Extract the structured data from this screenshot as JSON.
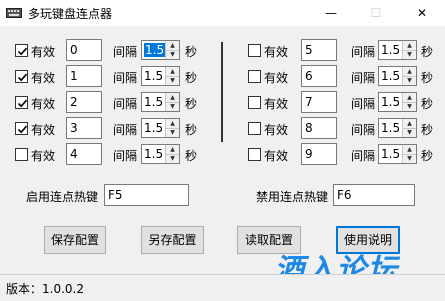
{
  "window": {
    "title": "多玩键盘连点器",
    "minimize": "—",
    "maximize": "☐",
    "close": "✕"
  },
  "rows_left": [
    {
      "checked": true,
      "enabled_label": "有效",
      "key": "0",
      "interval_label": "间隔",
      "interval": "1.5",
      "unit": "秒",
      "selected": true
    },
    {
      "checked": true,
      "enabled_label": "有效",
      "key": "1",
      "interval_label": "间隔",
      "interval": "1.5",
      "unit": "秒",
      "selected": false
    },
    {
      "checked": true,
      "enabled_label": "有效",
      "key": "2",
      "interval_label": "间隔",
      "interval": "1.5",
      "unit": "秒",
      "selected": false
    },
    {
      "checked": true,
      "enabled_label": "有效",
      "key": "3",
      "interval_label": "间隔",
      "interval": "1.5",
      "unit": "秒",
      "selected": false
    },
    {
      "checked": false,
      "enabled_label": "有效",
      "key": "4",
      "interval_label": "间隔",
      "interval": "1.5",
      "unit": "秒",
      "selected": false
    }
  ],
  "rows_right": [
    {
      "checked": false,
      "enabled_label": "有效",
      "key": "5",
      "interval_label": "间隔",
      "interval": "1.5",
      "unit": "秒"
    },
    {
      "checked": false,
      "enabled_label": "有效",
      "key": "6",
      "interval_label": "间隔",
      "interval": "1.5",
      "unit": "秒"
    },
    {
      "checked": false,
      "enabled_label": "有效",
      "key": "7",
      "interval_label": "间隔",
      "interval": "1.5",
      "unit": "秒"
    },
    {
      "checked": false,
      "enabled_label": "有效",
      "key": "8",
      "interval_label": "间隔",
      "interval": "1.5",
      "unit": "秒"
    },
    {
      "checked": false,
      "enabled_label": "有效",
      "key": "9",
      "interval_label": "间隔",
      "interval": "1.5",
      "unit": "秒"
    }
  ],
  "hotkeys": {
    "enable_label": "启用连点热键",
    "enable_value": "F5",
    "disable_label": "禁用连点热键",
    "disable_value": "F6"
  },
  "buttons": {
    "save": "保存配置",
    "save_as": "另存配置",
    "load": "读取配置",
    "help": "使用说明"
  },
  "status": {
    "version": "版本：1.0.0.2"
  },
  "watermark": "酒入论坛",
  "colors": {
    "accent": "#0078d7",
    "watermark": "#1e88e5"
  }
}
